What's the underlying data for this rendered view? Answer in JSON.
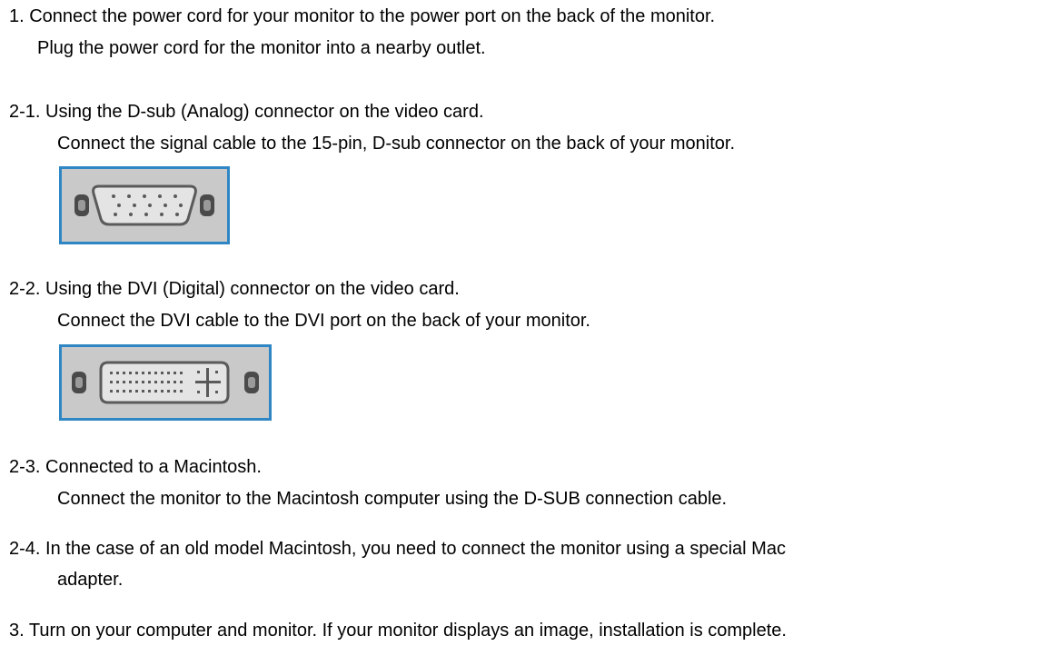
{
  "steps": {
    "step1": {
      "line1": "1. Connect the power cord for your monitor to the power port on the back of the monitor.",
      "line2": "Plug the power cord for the monitor into a nearby outlet."
    },
    "step2_1": {
      "line1": "2-1. Using the D-sub (Analog) connector on the video card.",
      "line2": "Connect the signal cable to the 15-pin, D-sub connector on the back of your monitor.",
      "image_icon": "dsub-connector-icon"
    },
    "step2_2": {
      "line1": "2-2. Using the DVI (Digital) connector on the video card.",
      "line2": "Connect the DVI cable to the DVI port on the back of your monitor.",
      "image_icon": "dvi-connector-icon"
    },
    "step2_3": {
      "line1": "2-3. Connected to a Macintosh.",
      "line2": "Connect the monitor to the Macintosh computer using the D-SUB connection cable."
    },
    "step2_4": {
      "line1": "2-4. In the case of an old model Macintosh, you need to connect the monitor using a special Mac",
      "line2": "adapter."
    },
    "step3": {
      "line1": "3. Turn on your computer and monitor. If your monitor displays an image, installation is complete."
    }
  },
  "colors": {
    "text": "#000000",
    "figure_border": "#2f86c4",
    "figure_bg": "#c9c9c9",
    "connector_fill": "#e4e4e4",
    "connector_stroke": "#5a5a5a",
    "screw_fill": "#4a4a4a"
  }
}
